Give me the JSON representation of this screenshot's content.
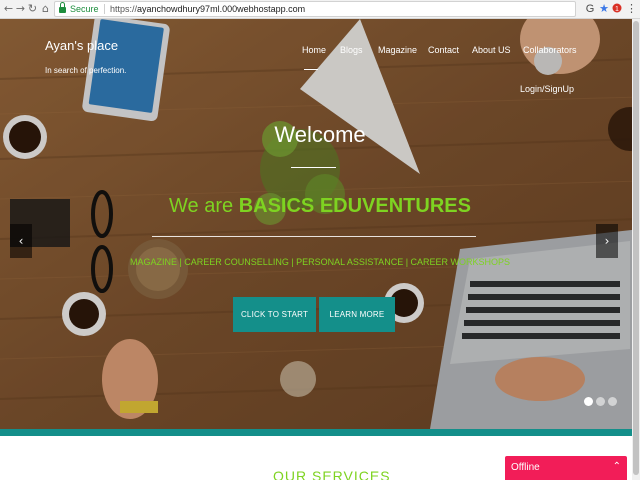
{
  "browser": {
    "secure_label": "Secure",
    "url_scheme": "https://",
    "url_rest": "ayanchowdhury97ml.000webhostapp.com",
    "icons": [
      "back-icon",
      "forward-icon",
      "reload-icon",
      "home-icon",
      "lock-icon",
      "translate-icon",
      "star-icon",
      "extension-icon",
      "menu-icon"
    ]
  },
  "site": {
    "brand": "Ayan's place",
    "tagline": "In search of perfection."
  },
  "nav": {
    "items": [
      {
        "label": "Home"
      },
      {
        "label": "Blogs"
      },
      {
        "label": "Magazine"
      },
      {
        "label": "Contact"
      },
      {
        "label": "About US"
      },
      {
        "label": "Collaborators"
      }
    ],
    "login": "Login/SignUp"
  },
  "hero": {
    "welcome": "Welcome",
    "headline_prefix": "We are ",
    "headline_strong": "BASICS EDUVENTURES",
    "services_line": "MAGAZINE | CAREER COUNSELLING | PERSONAL ASSISTANCE | CAREER WORKSHOPS",
    "buttons": [
      {
        "label": "CLICK TO START"
      },
      {
        "label": "LEARN MORE"
      }
    ],
    "slides_total": 3,
    "slide_active": 1,
    "prev_glyph": "‹",
    "next_glyph": "›"
  },
  "services": {
    "title": "OUR SERVICES"
  },
  "chat": {
    "label": "Offline",
    "chevron": "⌃"
  },
  "colors": {
    "accent_green": "#7ed321",
    "teal": "#148f8a",
    "chat_pink": "#f21d58"
  }
}
